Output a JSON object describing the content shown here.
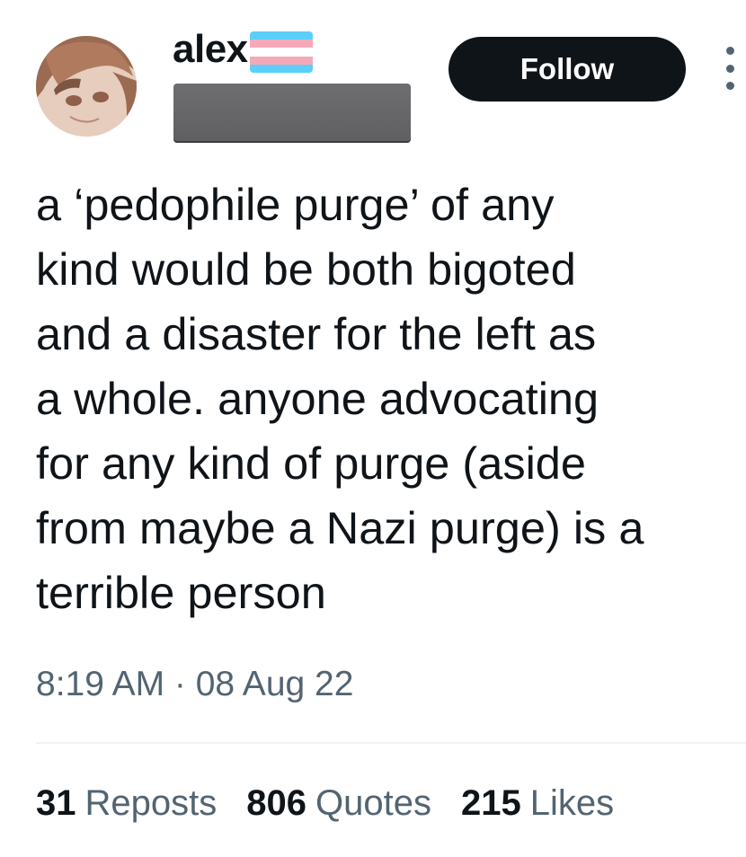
{
  "user": {
    "display_name": "alex",
    "flag_icon": "transgender-pride-flag-emoji",
    "flag_colors": [
      "#5bcefa",
      "#f5a9b8",
      "#ffffff",
      "#f5a9b8",
      "#5bcefa"
    ]
  },
  "actions": {
    "follow_label": "Follow",
    "more_icon": "vertical-ellipsis-icon"
  },
  "tweet": {
    "text": "a ‘pedophile purge’ of any\nkind would be both bigoted\nand a disaster for the left as\na whole. anyone advocating\nfor any kind of purge (aside\nfrom maybe a Nazi purge) is a\nterrible person",
    "timestamp": "8:19 AM · 08 Aug 22"
  },
  "stats": {
    "reposts_count": "31",
    "reposts_label": "Reposts",
    "quotes_count": "806",
    "quotes_label": "Quotes",
    "likes_count": "215",
    "likes_label": "Likes"
  },
  "colors": {
    "text_primary": "#0f1419",
    "text_secondary": "#536471",
    "button_bg": "#0f1419",
    "divider": "#eff3f4"
  }
}
